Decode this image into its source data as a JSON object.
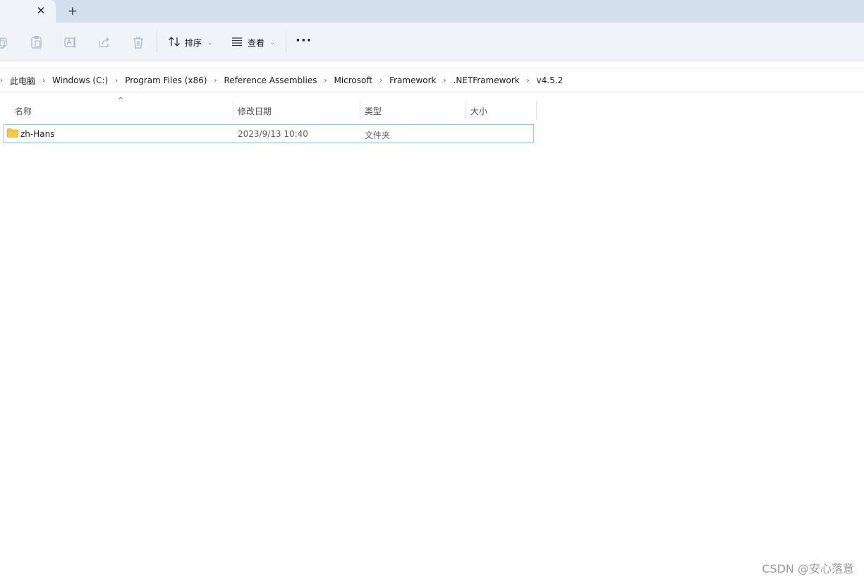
{
  "tabs": {
    "close_glyph": "✕",
    "new_tab_glyph": "+"
  },
  "toolbar": {
    "sort_label": "排序",
    "view_label": "查看",
    "more_label": "···",
    "chevron": "⌄"
  },
  "breadcrumbs": [
    "此电脑",
    "Windows (C:)",
    "Program Files (x86)",
    "Reference Assemblies",
    "Microsoft",
    "Framework",
    ".NETFramework",
    "v4.5.2"
  ],
  "columns": {
    "name": "名称",
    "date": "修改日期",
    "type": "类型",
    "size": "大小"
  },
  "files": [
    {
      "name": "zh-Hans",
      "date": "2023/9/13 10:40",
      "type": "文件夹",
      "size": ""
    }
  ],
  "watermark": "CSDN @安心落意",
  "colors": {
    "tabstrip": "#d3dfec",
    "toolbar": "#f0f4f9",
    "selection_border": "#99c9ef",
    "folder": "#f8c84a"
  }
}
